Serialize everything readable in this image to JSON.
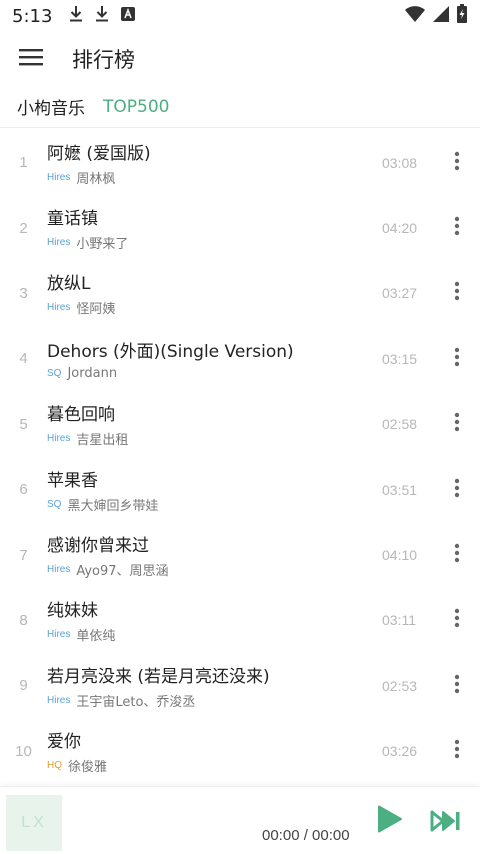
{
  "status_bar": {
    "time": "5:13",
    "icons": [
      "download-icon",
      "download-icon",
      "app-notification-icon",
      "wifi-icon",
      "signal-icon",
      "battery-charging-icon"
    ]
  },
  "header": {
    "title": "排行榜",
    "menu_icon": "hamburger-menu-icon"
  },
  "source": {
    "name": "小枸音乐",
    "board": "TOP500"
  },
  "colors": {
    "accent": "#4caf82",
    "quality_hires": "#5aa3d6",
    "quality_hq": "#e0a030"
  },
  "songs": [
    {
      "index": "1",
      "title": "阿嬷 (爱国版)",
      "quality": "Hires",
      "singer": "周林枫",
      "duration": "03:08"
    },
    {
      "index": "2",
      "title": "童话镇",
      "quality": "Hires",
      "singer": "小野来了",
      "duration": "04:20"
    },
    {
      "index": "3",
      "title": "放纵L",
      "quality": "Hires",
      "singer": "怪阿姨",
      "duration": "03:27"
    },
    {
      "index": "4",
      "title": "Dehors (外面)(Single Version)",
      "quality": "SQ",
      "singer": "Jordann",
      "duration": "03:15"
    },
    {
      "index": "5",
      "title": "暮色回响",
      "quality": "Hires",
      "singer": "吉星出租",
      "duration": "02:58"
    },
    {
      "index": "6",
      "title": "苹果香",
      "quality": "SQ",
      "singer": "黑大婶回乡带娃",
      "duration": "03:51"
    },
    {
      "index": "7",
      "title": "感谢你曾来过",
      "quality": "Hires",
      "singer": "Ayo97、周思涵",
      "duration": "04:10"
    },
    {
      "index": "8",
      "title": "纯妹妹",
      "quality": "Hires",
      "singer": "单依纯",
      "duration": "03:11"
    },
    {
      "index": "9",
      "title": "若月亮没来 (若是月亮还没来)",
      "quality": "Hires",
      "singer": "王宇宙Leto、乔浚丞",
      "duration": "02:53"
    },
    {
      "index": "10",
      "title": "爱你",
      "quality": "HQ",
      "singer": "徐俊雅",
      "duration": "03:26"
    }
  ],
  "player": {
    "cover_text": "LX",
    "time": "00:00 / 00:00",
    "play_icon": "play-icon",
    "next_icon": "skip-next-icon"
  }
}
